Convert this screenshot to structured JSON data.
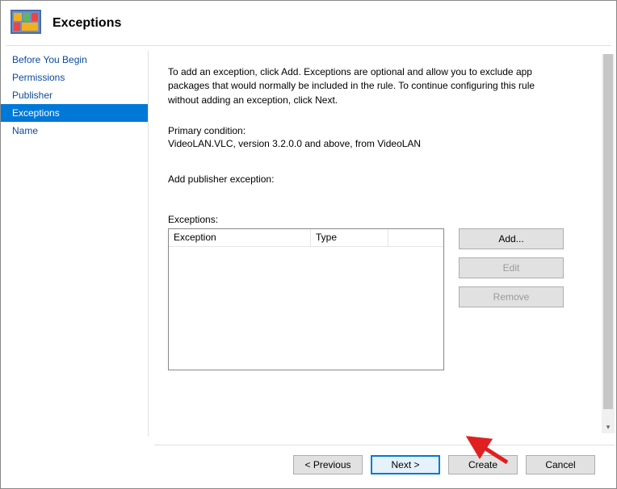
{
  "title": "Exceptions",
  "sidebar": {
    "items": [
      {
        "label": "Before You Begin"
      },
      {
        "label": "Permissions"
      },
      {
        "label": "Publisher"
      },
      {
        "label": "Exceptions"
      },
      {
        "label": "Name"
      }
    ]
  },
  "content": {
    "description": "To add an exception, click Add. Exceptions are optional and allow you to exclude app packages that would normally be included in the rule. To continue configuring this rule without adding an exception, click Next.",
    "primary_condition_label": "Primary condition:",
    "primary_condition_value": "VideoLAN.VLC, version 3.2.0.0 and above, from VideoLAN",
    "add_publisher_label": "Add publisher exception:",
    "exceptions_label": "Exceptions:",
    "columns": {
      "exception": "Exception",
      "type": "Type"
    },
    "buttons": {
      "add": "Add...",
      "edit": "Edit",
      "remove": "Remove"
    }
  },
  "footer": {
    "previous": "< Previous",
    "next": "Next >",
    "create": "Create",
    "cancel": "Cancel"
  }
}
